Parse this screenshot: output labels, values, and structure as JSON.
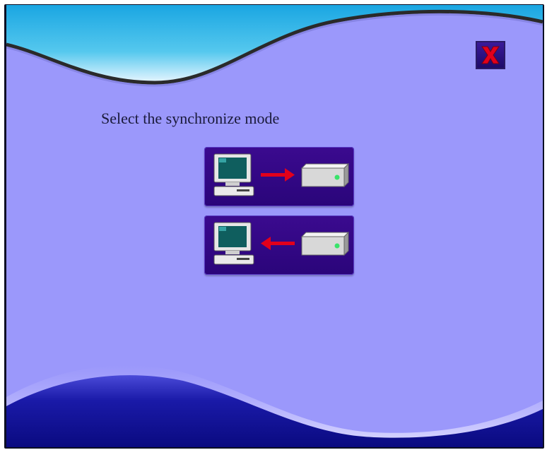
{
  "dialog": {
    "title": "Select the synchronize mode"
  },
  "buttons": {
    "close": {
      "icon": "close-x-icon",
      "color": "#e3001b"
    },
    "pc_to_device": {
      "icons": [
        "computer-icon",
        "arrow-right-icon",
        "device-icon"
      ]
    },
    "device_to_pc": {
      "icons": [
        "computer-icon",
        "arrow-left-icon",
        "device-icon"
      ]
    }
  },
  "colors": {
    "background": "#9b98fb",
    "top_wave": "#2bb7ea",
    "bottom_wave": "#0d0f9a",
    "button_bg": "#34088a",
    "arrow": "#e3001b",
    "led": "#39e36a"
  }
}
